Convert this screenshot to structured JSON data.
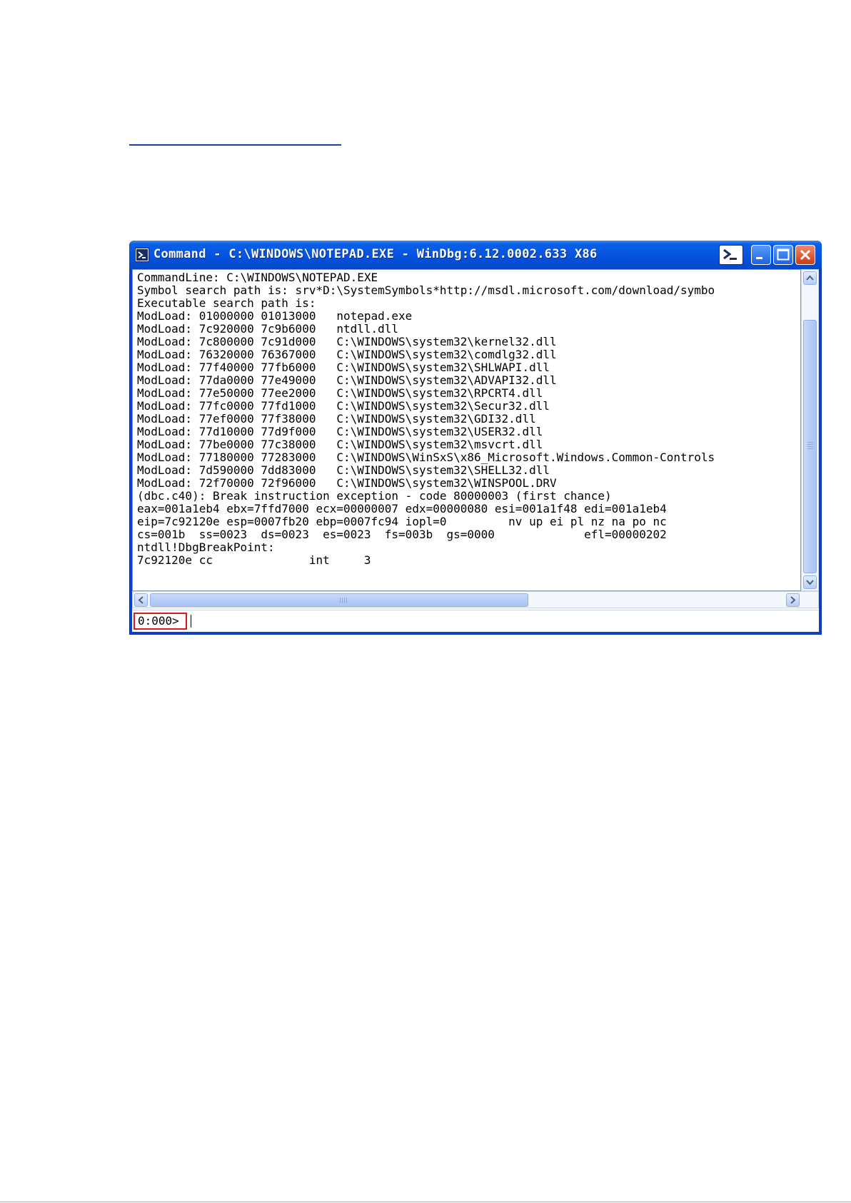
{
  "window": {
    "title": "Command - C:\\WINDOWS\\NOTEPAD.EXE - WinDbg:6.12.0002.633 X86"
  },
  "output": {
    "lines": [
      "CommandLine: C:\\WINDOWS\\NOTEPAD.EXE",
      "Symbol search path is: srv*D:\\SystemSymbols*http://msdl.microsoft.com/download/symbo",
      "Executable search path is:",
      "ModLoad: 01000000 01013000   notepad.exe",
      "ModLoad: 7c920000 7c9b6000   ntdll.dll",
      "ModLoad: 7c800000 7c91d000   C:\\WINDOWS\\system32\\kernel32.dll",
      "ModLoad: 76320000 76367000   C:\\WINDOWS\\system32\\comdlg32.dll",
      "ModLoad: 77f40000 77fb6000   C:\\WINDOWS\\system32\\SHLWAPI.dll",
      "ModLoad: 77da0000 77e49000   C:\\WINDOWS\\system32\\ADVAPI32.dll",
      "ModLoad: 77e50000 77ee2000   C:\\WINDOWS\\system32\\RPCRT4.dll",
      "ModLoad: 77fc0000 77fd1000   C:\\WINDOWS\\system32\\Secur32.dll",
      "ModLoad: 77ef0000 77f38000   C:\\WINDOWS\\system32\\GDI32.dll",
      "ModLoad: 77d10000 77d9f000   C:\\WINDOWS\\system32\\USER32.dll",
      "ModLoad: 77be0000 77c38000   C:\\WINDOWS\\system32\\msvcrt.dll",
      "ModLoad: 77180000 77283000   C:\\WINDOWS\\WinSxS\\x86_Microsoft.Windows.Common-Controls",
      "ModLoad: 7d590000 7dd83000   C:\\WINDOWS\\system32\\SHELL32.dll",
      "ModLoad: 72f70000 72f96000   C:\\WINDOWS\\system32\\WINSPOOL.DRV",
      "(dbc.c40): Break instruction exception - code 80000003 (first chance)",
      "eax=001a1eb4 ebx=7ffd7000 ecx=00000007 edx=00000080 esi=001a1f48 edi=001a1eb4",
      "eip=7c92120e esp=0007fb20 ebp=0007fc94 iopl=0         nv up ei pl nz na po nc",
      "cs=001b  ss=0023  ds=0023  es=0023  fs=003b  gs=0000             efl=00000202",
      "ntdll!DbgBreakPoint:",
      "7c92120e cc              int     3"
    ]
  },
  "command": {
    "prompt": "0:000>",
    "value": ""
  },
  "icons": {
    "window_icon": "command-prompt-icon",
    "title_button_icon": "command-prompt-icon",
    "minimize": "minimize-icon",
    "maximize": "maximize-icon",
    "close": "close-icon"
  },
  "colors": {
    "titlebar": "#0553e0",
    "prompt_highlight": "#e0191f"
  }
}
